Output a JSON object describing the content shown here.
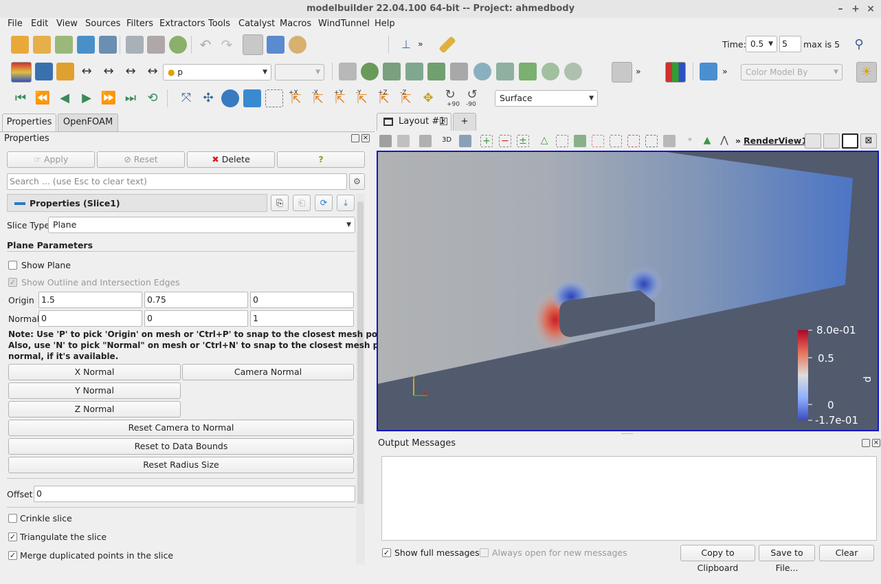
{
  "window": {
    "title": "modelbuilder 22.04.100 64-bit -- Project: ahmedbody"
  },
  "menu": [
    "File",
    "Edit",
    "View",
    "Sources",
    "Filters",
    "Extractors",
    "Tools",
    "Catalyst",
    "Macros",
    "WindTunnel",
    "Help"
  ],
  "toolbar1": {
    "overflow": "»",
    "time_label": "Time:",
    "time_value": "0.5",
    "time_index": "5",
    "max_label": "max is 5"
  },
  "toolbar2": {
    "array_value": "p",
    "component_value": "",
    "color_model_placeholder": "Color Model By",
    "overflow": "»"
  },
  "toolbar3": {
    "labels": [
      "+X",
      "-X",
      "+Y",
      "-Y",
      "+Z",
      "-Z",
      "+90",
      "-90"
    ],
    "representation": "Surface"
  },
  "left_tabs": [
    "Properties",
    "OpenFOAM"
  ],
  "properties": {
    "panel_title": "Properties",
    "apply_label": "Apply",
    "reset_label": "Reset",
    "delete_label": "Delete",
    "help_label": "?",
    "search_placeholder": "Search ... (use Esc to clear text)",
    "section_title": "Properties (Slice1)",
    "slice_type_label": "Slice Type",
    "slice_type_value": "Plane",
    "plane_params_title": "Plane Parameters",
    "show_plane_label": "Show Plane",
    "show_outline_label": "Show Outline and Intersection Edges",
    "origin_label": "Origin",
    "origin": [
      "1.5",
      "0.75",
      "0"
    ],
    "normal_label": "Normal",
    "normal": [
      "0",
      "0",
      "1"
    ],
    "note_line1": "Note: Use 'P' to pick 'Origin' on mesh or 'Ctrl+P' to snap to the closest mesh point.",
    "note_line2": "Also, use 'N' to pick \"Normal\" on mesh or 'Ctrl+N' to snap to the closest mesh point",
    "note_line3": "normal, if it's available.",
    "x_normal": "X Normal",
    "camera_normal": "Camera Normal",
    "y_normal": "Y Normal",
    "z_normal": "Z Normal",
    "reset_camera": "Reset Camera to Normal",
    "reset_bounds": "Reset to Data Bounds",
    "reset_radius": "Reset Radius Size",
    "offset_label": "Offset",
    "offset_value": "0",
    "crinkle_label": "Crinkle slice",
    "triangulate_label": "Triangulate the slice",
    "merge_label": "Merge duplicated points in the slice"
  },
  "layout": {
    "tab_label": "Layout #1",
    "add_tab": "+",
    "view_label": "RenderView1",
    "overflow": "»",
    "view3d_label": "3D"
  },
  "colorbar": {
    "title": "p",
    "ticks": [
      "8.0e-01",
      "0.5",
      "0",
      "-1.7e-01"
    ]
  },
  "axes": {
    "y_label": "Y"
  },
  "output": {
    "title": "Output Messages",
    "show_full_label": "Show full messages",
    "always_open_label": "Always open for new messages",
    "copy_label": "Copy to Clipboard",
    "save_label": "Save to File...",
    "clear_label": "Clear"
  },
  "colors": {
    "accent_blue": "#1515c8",
    "delete_red": "#d42020",
    "background_slate": "#525a6e"
  }
}
